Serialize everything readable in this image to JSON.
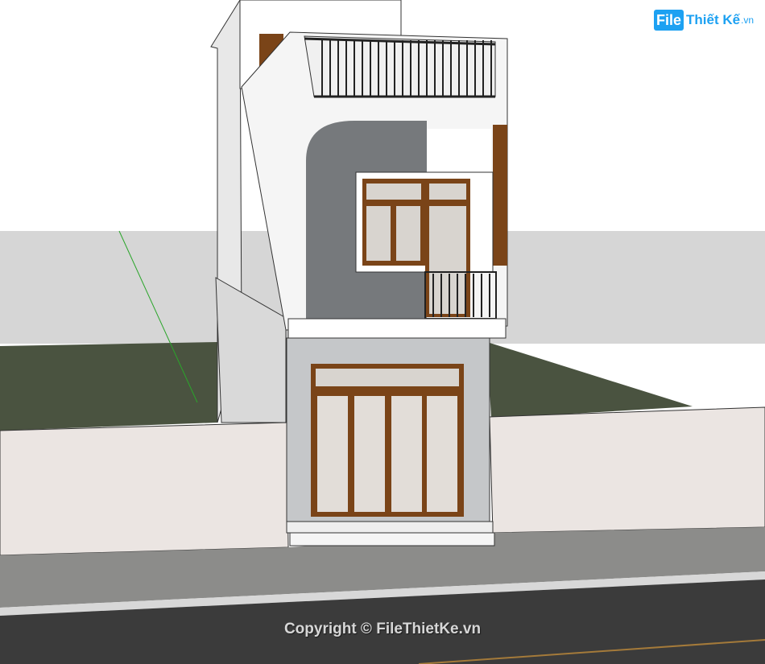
{
  "watermark": {
    "logo_mark": "File",
    "logo_word": "Thiết Kế",
    "logo_tld": ".vn",
    "copyright": "Copyright © FileThietKe.vn"
  },
  "colors": {
    "sky": "#ffffff",
    "horizon": "#d6d6d6",
    "lawn": "#4a5340",
    "fence": "#ebe5e2",
    "sidewalk": "#8c8c8a",
    "road": "#3b3b3b",
    "wall_white": "#f5f5f5",
    "wall_grey": "#76797c",
    "stone": "#c5c7c9",
    "wood": "#7a4418",
    "logo_blue": "#1da1f2"
  }
}
